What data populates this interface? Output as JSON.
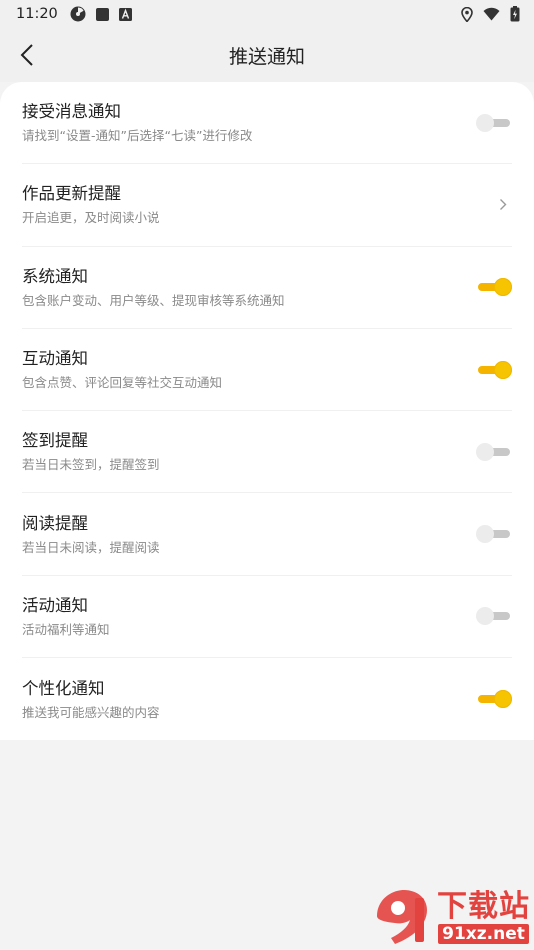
{
  "status_bar": {
    "time": "11:20",
    "left_icons": [
      "radiation-icon",
      "square-app-icon",
      "a-app-icon"
    ],
    "right_icons": [
      "location-icon",
      "wifi-icon",
      "battery-icon"
    ]
  },
  "header": {
    "title": "推送通知",
    "back_icon": "chevron-left-icon"
  },
  "settings": [
    {
      "title": "接受消息通知",
      "subtitle": "请找到“设置-通知”后选择“七读”进行修改",
      "control": "switch",
      "on": false
    },
    {
      "title": "作品更新提醒",
      "subtitle": "开启追更，及时阅读小说",
      "control": "chevron"
    },
    {
      "title": "系统通知",
      "subtitle": "包含账户变动、用户等级、提现审核等系统通知",
      "control": "switch",
      "on": true
    },
    {
      "title": "互动通知",
      "subtitle": "包含点赞、评论回复等社交互动通知",
      "control": "switch",
      "on": true
    },
    {
      "title": "签到提醒",
      "subtitle": "若当日未签到，提醒签到",
      "control": "switch",
      "on": false
    },
    {
      "title": "阅读提醒",
      "subtitle": "若当日未阅读，提醒阅读",
      "control": "switch",
      "on": false
    },
    {
      "title": "活动通知",
      "subtitle": "活动福利等通知",
      "control": "switch",
      "on": false
    },
    {
      "title": "个性化通知",
      "subtitle": "推送我可能感兴趣的内容",
      "control": "switch",
      "on": true
    }
  ],
  "colors": {
    "accent": "#f6c400",
    "switch_off": "#c8c8c8",
    "watermark": "#e3433f"
  },
  "watermark": {
    "cn": "下载站",
    "en": "91xz.net"
  }
}
